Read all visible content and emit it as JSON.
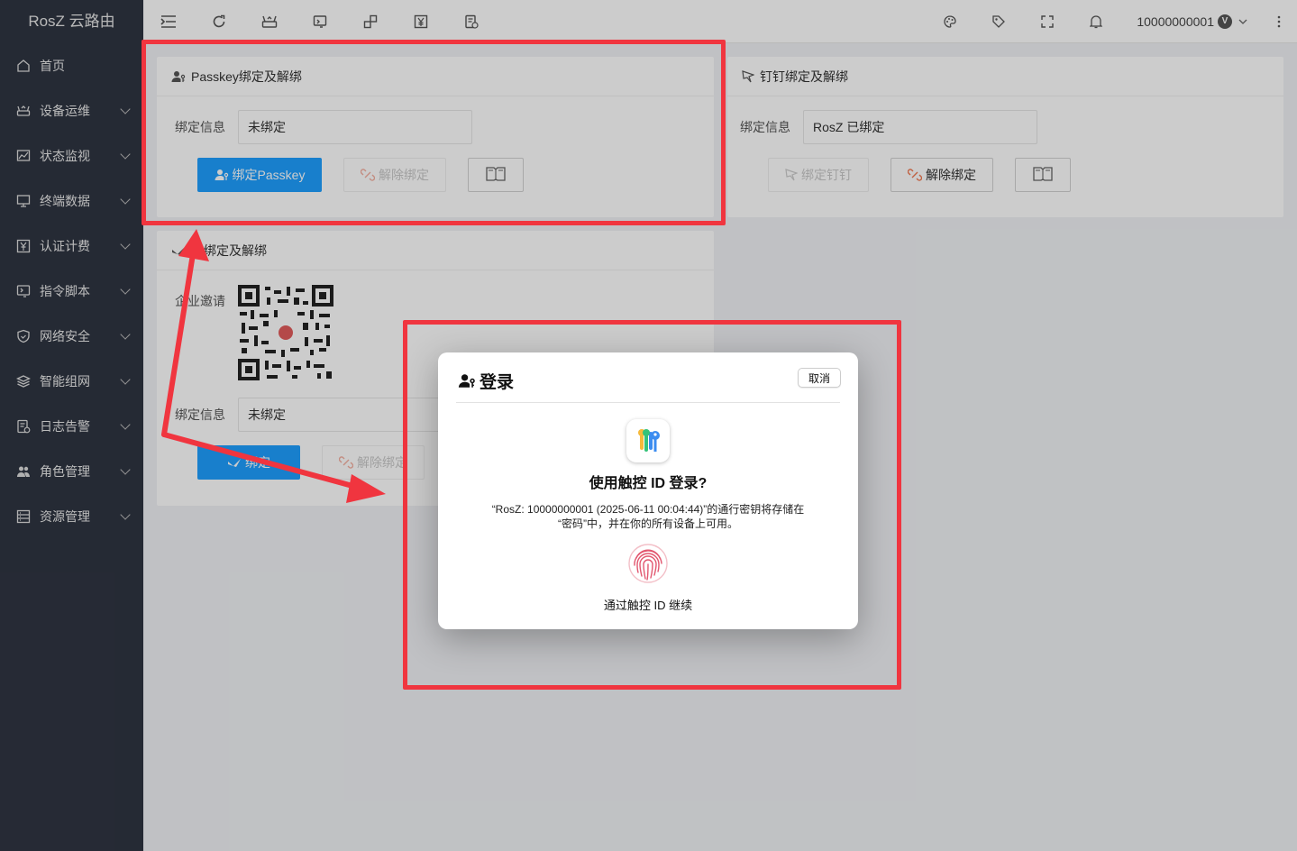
{
  "app": {
    "title": "RosZ 云路由"
  },
  "sidebar": {
    "items": [
      {
        "label": "首页",
        "icon": "home-icon",
        "expandable": false
      },
      {
        "label": "设备运维",
        "icon": "router-icon",
        "expandable": true
      },
      {
        "label": "状态监视",
        "icon": "chart-icon",
        "expandable": true
      },
      {
        "label": "终端数据",
        "icon": "monitor-icon",
        "expandable": true
      },
      {
        "label": "认证计费",
        "icon": "yen-icon",
        "expandable": true
      },
      {
        "label": "指令脚本",
        "icon": "script-icon",
        "expandable": true
      },
      {
        "label": "网络安全",
        "icon": "shield-icon",
        "expandable": true
      },
      {
        "label": "智能组网",
        "icon": "layers-icon",
        "expandable": true
      },
      {
        "label": "日志告警",
        "icon": "log-icon",
        "expandable": true
      },
      {
        "label": "角色管理",
        "icon": "users-icon",
        "expandable": true
      },
      {
        "label": "资源管理",
        "icon": "resource-icon",
        "expandable": true
      }
    ]
  },
  "header": {
    "user": "10000000001",
    "badge": "V"
  },
  "passkey_card": {
    "title": "Passkey绑定及解绑",
    "info_label": "绑定信息",
    "info_value": "未绑定",
    "bind_label": "绑定Passkey",
    "unbind_label": "解除绑定"
  },
  "dingtalk_card": {
    "title": "钉钉绑定及解绑",
    "info_label": "绑定信息",
    "info_value": "RosZ 已绑定",
    "bind_label": "绑定钉钉",
    "unbind_label": "解除绑定"
  },
  "feishu_card": {
    "title": "书绑定及解绑",
    "invite_label": "企业邀请",
    "info_label": "绑定信息",
    "info_value": "未绑定",
    "bind_label": "绑定",
    "unbind_label": "解除绑定"
  },
  "dialog": {
    "title": "登录",
    "cancel": "取消",
    "heading": "使用触控 ID 登录?",
    "message_line1": "“RosZ: 10000000001 (2025-06-11 00:04:44)”的通行密钥将存储在",
    "message_line2": "“密码”中，并在你的所有设备上可用。",
    "footer": "通过触控 ID 继续"
  },
  "colors": {
    "sidebar": "#2f3542",
    "primary": "#1e9fff",
    "highlight": "#f0353f"
  }
}
